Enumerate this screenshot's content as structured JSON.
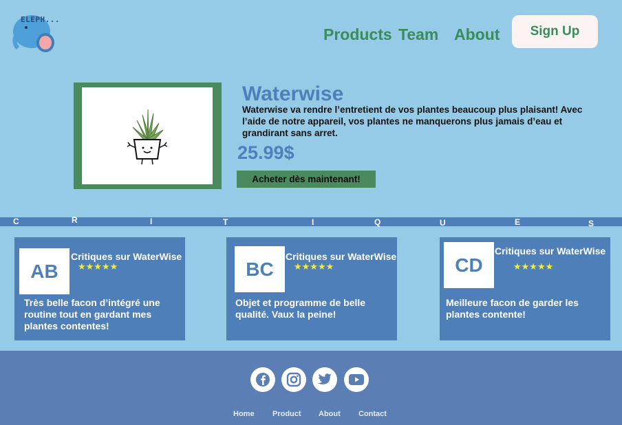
{
  "header": {
    "logo_text": "ELEPH...",
    "nav": {
      "products": "Products",
      "team": "Team",
      "about": "About"
    },
    "signup_label": "Sign Up"
  },
  "product": {
    "title": "Waterwise",
    "description": "Waterwise va rendre l’entretient de vos plantes beaucoup plus plaisant! Avec l’aide de notre appareil, vos plantes ne manquerons plus jamais d’eau et grandirant sans arret.",
    "price": "25.99$",
    "buy_label": "Acheter dès maintenant!"
  },
  "critiques_letters": [
    "C",
    "R",
    "I",
    "T",
    "I",
    "Q",
    "U",
    "E",
    "S"
  ],
  "reviews": [
    {
      "initials": "AB",
      "title": "Critiques sur WaterWise",
      "stars": "★★★★★",
      "text": "Très belle facon d’intégré une routine tout en gardant mes plantes contentes!"
    },
    {
      "initials": "BC",
      "title": "Critiques sur WaterWise",
      "stars": "★★★★★",
      "text": "Objet et programme de belle qualité. Vaux la peine!"
    },
    {
      "initials": "CD",
      "title": "Critiques sur WaterWise",
      "stars": "★★★★★",
      "text": "Meilleure facon de garder les plantes contente!"
    }
  ],
  "footer": {
    "social_icons": [
      "facebook-icon",
      "instagram-icon",
      "twitter-icon",
      "youtube-icon"
    ],
    "links": {
      "home": "Home",
      "product": "Product",
      "about": "About",
      "contact": "Contact"
    }
  }
}
